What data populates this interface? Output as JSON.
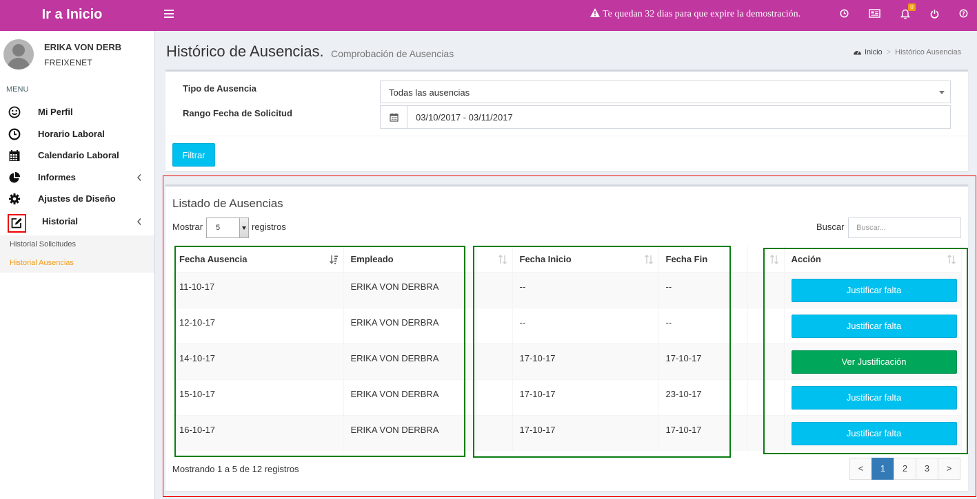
{
  "topbar": {
    "brand": "Ir a Inicio",
    "notice": "Te quedan 32 dias para que expire la demostración.",
    "notification_count": "0",
    "icons": [
      "clock-icon",
      "newspaper-icon",
      "bell-icon",
      "power-icon",
      "help-icon"
    ]
  },
  "user": {
    "name": "ERIKA VON DERB",
    "company": "FREIXENET"
  },
  "sidebar": {
    "header": "MENU",
    "items": [
      {
        "label": "Mi Perfil",
        "icon": "smile-icon"
      },
      {
        "label": "Horario Laboral",
        "icon": "clock-icon"
      },
      {
        "label": "Calendario Laboral",
        "icon": "calendar-icon"
      },
      {
        "label": "Informes",
        "icon": "pie-chart-icon"
      },
      {
        "label": "Ajustes de Diseño",
        "icon": "gear-icon"
      },
      {
        "label": "Historial",
        "icon": "edit-icon"
      }
    ],
    "submenu": [
      {
        "label": "Historial Solicitudes",
        "active": false
      },
      {
        "label": "Historial Ausencias",
        "active": true
      }
    ]
  },
  "page": {
    "title": "Histórico de Ausencias.",
    "subtitle": "Comprobación de Ausencias",
    "breadcrumb": [
      "Inicio",
      "Histórico Ausencias"
    ]
  },
  "filters": {
    "type_label": "Tipo de Ausencia",
    "type_value": "Todas las ausencias",
    "range_label": "Rango Fecha de Solicitud",
    "range_value": "03/10/2017 - 03/11/2017",
    "button": "Filtrar"
  },
  "listing": {
    "title": "Listado de Ausencias",
    "show_label": "Mostrar",
    "show_value": "5",
    "show_after": "registros",
    "search_label": "Buscar",
    "search_placeholder": "Buscar...",
    "columns": [
      "Fecha Ausencia",
      "Empleado",
      "",
      "Fecha Inicio",
      "Fecha Fin",
      "",
      "Acción"
    ],
    "rows": [
      {
        "fecha": "11-10-17",
        "empleado": "ERIKA VON DERBRA",
        "extra1": "",
        "inicio": "--",
        "fin": "--",
        "extra2": "",
        "action": "Justificar falta",
        "action_type": "info"
      },
      {
        "fecha": "12-10-17",
        "empleado": "ERIKA VON DERBRA",
        "extra1": "",
        "inicio": "--",
        "fin": "--",
        "extra2": "",
        "action": "Justificar falta",
        "action_type": "info"
      },
      {
        "fecha": "14-10-17",
        "empleado": "ERIKA VON DERBRA",
        "extra1": "",
        "inicio": "17-10-17",
        "fin": "17-10-17",
        "extra2": "",
        "action": "Ver Justificación",
        "action_type": "success"
      },
      {
        "fecha": "15-10-17",
        "empleado": "ERIKA VON DERBRA",
        "extra1": "",
        "inicio": "17-10-17",
        "fin": "23-10-17",
        "extra2": "",
        "action": "Justificar falta",
        "action_type": "info"
      },
      {
        "fecha": "16-10-17",
        "empleado": "ERIKA VON DERBRA",
        "extra1": "",
        "inicio": "17-10-17",
        "fin": "17-10-17",
        "extra2": "",
        "action": "Justificar falta",
        "action_type": "info"
      }
    ],
    "info": "Mostrando 1 a 5 de 12 registros",
    "pages": [
      "<",
      "1",
      "2",
      "3",
      ">"
    ],
    "current_page": "1"
  },
  "colors": {
    "topbar": "#c0379f",
    "info": "#00c0ef",
    "success": "#00a65a",
    "active_link": "#f39c12",
    "highlight_red": "#ee0000",
    "highlight_green": "#0a7d12"
  }
}
